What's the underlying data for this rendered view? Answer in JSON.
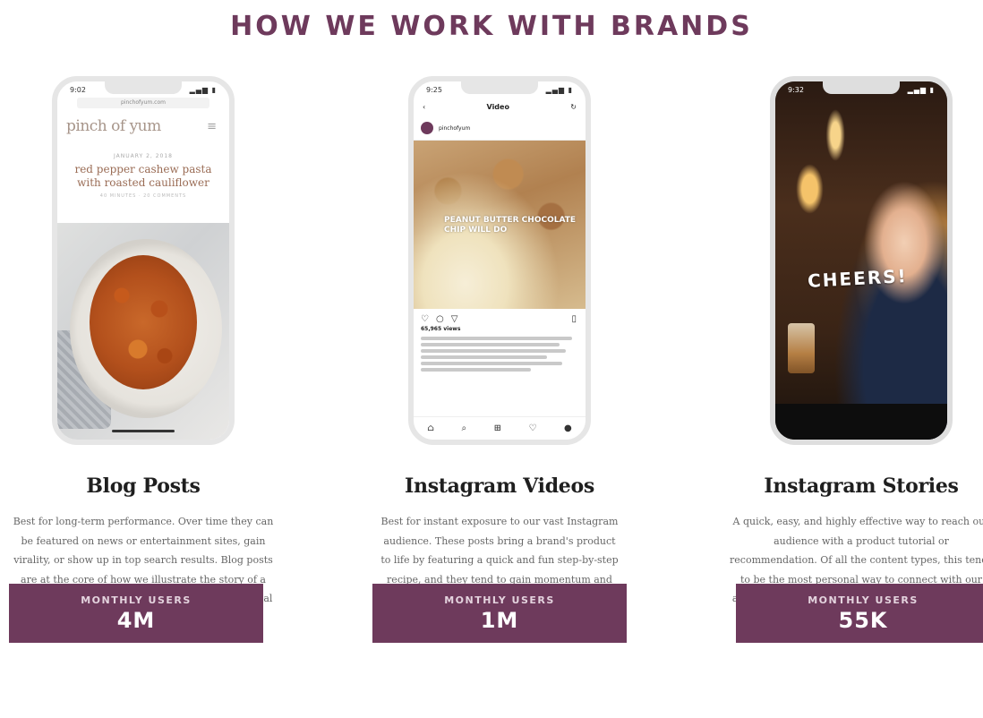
{
  "header": {
    "title": "HOW WE WORK WITH BRANDS"
  },
  "colors": {
    "accent": "#6e3a5c"
  },
  "columns": [
    {
      "title": "Blog Posts",
      "description": "Best for long-term performance. Over time they can be featured on news or entertainment sites, gain virality, or show up in top search results. Blog posts are at the core of how we illustrate the story of a brand, and they include beautiful imagery, personal notes on the recipe, and a full-text recipe.",
      "stat_label": "MONTHLY USERS",
      "stat_value": "4M",
      "phone": {
        "time": "9:02",
        "url": "pinchofyum.com",
        "logo": "pinch of yum",
        "post_date": "JANUARY 2, 2018",
        "post_title": "red pepper cashew pasta with roasted cauliflower",
        "post_meta": "40 MINUTES · 20 COMMENTS"
      }
    },
    {
      "title": "Instagram Videos",
      "description": "Best for instant exposure to our vast Instagram audience. These posts bring a brand's product to life by featuring a quick and fun step-by-step recipe, and they tend to gain momentum and engagement quickly.",
      "stat_label": "MONTHLY USERS",
      "stat_value": "1M",
      "phone": {
        "time": "9:25",
        "screen_title": "Video",
        "username": "pinchofyum",
        "video_overlay": "PEANUT BUTTER CHOCOLATE CHIP WILL DO",
        "views": "65,965 views"
      }
    },
    {
      "title": "Instagram Stories",
      "description": "A quick, easy, and highly effective way to reach our audience with a product tutorial or recommendation. Of all the content types, this tends to be the most personal way to connect with our audience since they involve a sequence of fun, real-life, narrated videos.",
      "stat_label": "MONTHLY USERS",
      "stat_value": "55K",
      "phone": {
        "time": "9:32",
        "story_text": "CHEERS!"
      }
    }
  ]
}
